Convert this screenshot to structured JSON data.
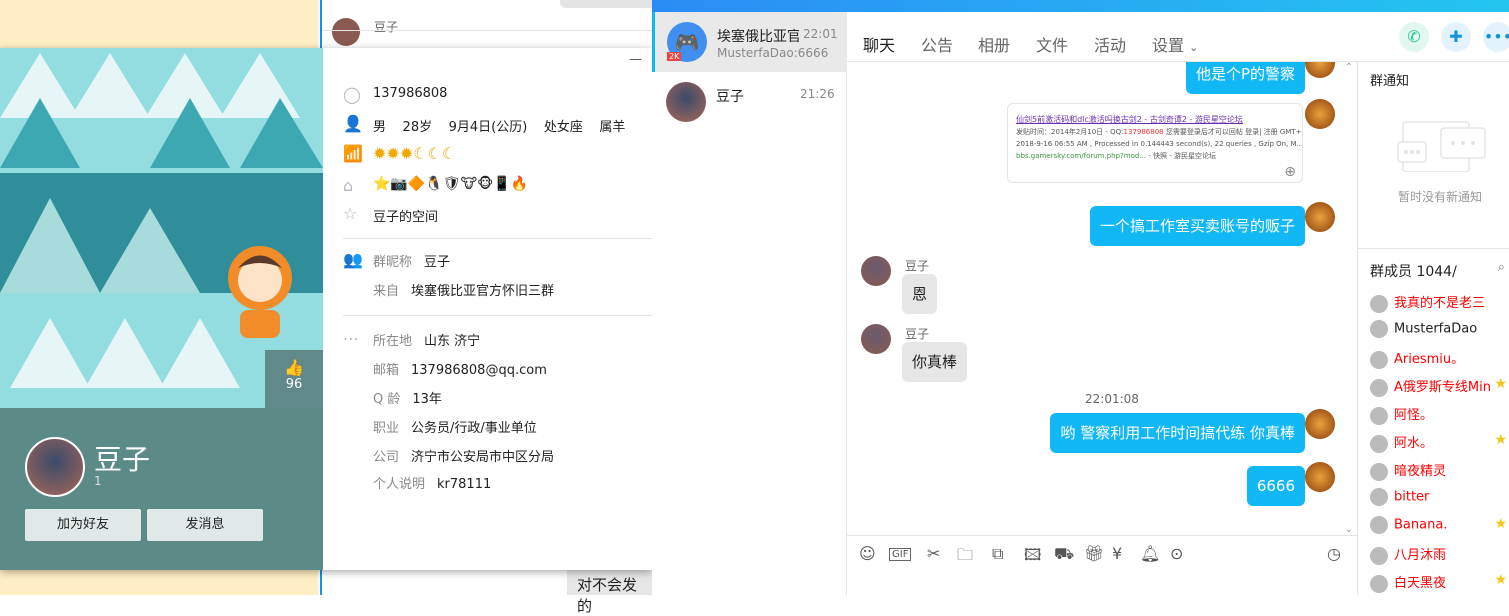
{
  "background": {
    "old_sender": "豆子",
    "old_bubble": "对不会发的"
  },
  "profile": {
    "name": "豆子",
    "sub": "1",
    "likes": "96",
    "buttons": {
      "add_friend": "加为好友",
      "send_message": "发消息"
    },
    "qq": "137986808",
    "basic": [
      "男",
      "28岁",
      "9月4日(公历)",
      "处女座",
      "属羊"
    ],
    "level_icons": [
      "sun",
      "sun",
      "sun",
      "moon",
      "moon",
      "moon"
    ],
    "space": "豆子的空间",
    "group_nick_label": "群昵称",
    "group_nick": "豆子",
    "from_label": "来自",
    "from": "埃塞俄比亚官方怀旧三群",
    "location_label": "所在地",
    "location": "山东 济宁",
    "email_label": "邮箱",
    "email": "137986808@qq.com",
    "qage_label": "Q 龄",
    "qage": "13年",
    "job_label": "职业",
    "job": "公务员/行政/事业单位",
    "company_label": "公司",
    "company": "济宁市公安局市中区分局",
    "bio_label": "个人说明",
    "bio": "kr78111",
    "minimize": "—"
  },
  "conversations": [
    {
      "name": "埃塞俄比亚官",
      "time": "22:01",
      "preview": "MusterfaDao:6666",
      "badge": "2K"
    },
    {
      "name": "豆子",
      "time": "21:26",
      "preview": ""
    }
  ],
  "tabs": [
    "聊天",
    "公告",
    "相册",
    "文件",
    "活动",
    "设置"
  ],
  "colors": {
    "accent": "#12B7F5",
    "red": "#FF0000"
  },
  "messages": {
    "m1": "他是个P的警察",
    "link": {
      "title": "仙剑5前激活码和dlc激活吗换古剑2 - 古剑奇谭2 - 游民星空论坛",
      "line1a": "发贴时间：2014年2月10日 - QQ:",
      "line1b": "137986808",
      "line1c": " 您需要登录后才可以回帖 登录| 注册 GMT+",
      "line2": "2018-9-16 06:55 AM , Processed in 0.144443 second(s), 22 queries , Gzip On, M...",
      "url": "bbs.gamersky.com/forum.php?mod...",
      "extra": " - 快照 - 游民星空论坛"
    },
    "m2": "一个搞工作室买卖账号的贩子",
    "sender": "豆子",
    "m3": "恩",
    "m4": "你真棒",
    "time": "22:01:08",
    "m5": "哟 警察利用工作时间搞代练 你真棒",
    "m6": "6666"
  },
  "notice": {
    "title": "群通知",
    "empty": "暂时没有新通知"
  },
  "members": {
    "title": "群成员 1044/",
    "list": [
      {
        "name": "我真的不是老三",
        "star": false
      },
      {
        "name": "MusterfaDao",
        "star": false
      },
      {
        "name": "Ariesmiu。",
        "star": false
      },
      {
        "name": "A俄罗斯专线Min",
        "star": true
      },
      {
        "name": "阿怪。",
        "star": false
      },
      {
        "name": "阿水。",
        "star": true
      },
      {
        "name": "暗夜精灵",
        "star": false
      },
      {
        "name": "bitter",
        "star": false
      },
      {
        "name": "Banana.",
        "star": true
      },
      {
        "name": "八月沐雨",
        "star": false
      },
      {
        "name": "白天黑夜",
        "star": true
      }
    ]
  }
}
